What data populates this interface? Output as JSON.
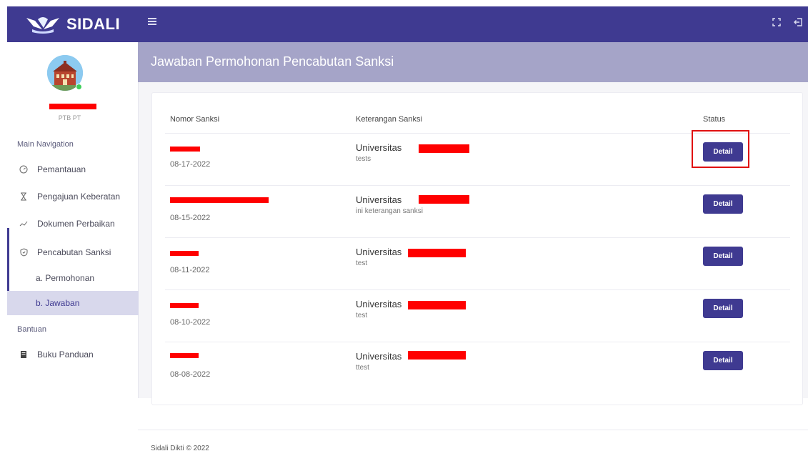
{
  "app": {
    "name": "SIDALI"
  },
  "navbar": {
    "menu_icon": "hamburger-icon",
    "fullscreen_icon": "fullscreen-icon",
    "logout_icon": "logout-icon"
  },
  "colors": {
    "primary": "#3f3a91",
    "header": "#a5a4c8",
    "active_nav": "#d8d8ec",
    "highlight": "#e01010",
    "redaction": "#ff0000"
  },
  "sidebar": {
    "user_role": "PTB PT",
    "sections": [
      {
        "label": "Main Navigation"
      },
      {
        "label": "Bantuan"
      }
    ],
    "items": [
      {
        "label": "Pemantauan",
        "icon": "gauge-icon"
      },
      {
        "label": "Pengajuan Keberatan",
        "icon": "hourglass-icon"
      },
      {
        "label": "Dokumen Perbaikan",
        "icon": "trend-icon"
      },
      {
        "label": "Pencabutan Sanksi",
        "icon": "shield-icon"
      },
      {
        "label": "a. Permohonan"
      },
      {
        "label": "b. Jawaban",
        "active": true
      },
      {
        "label": "Buku Panduan",
        "icon": "book-icon"
      }
    ]
  },
  "page": {
    "title": "Jawaban Permohonan Pencabutan Sanksi"
  },
  "table": {
    "headers": [
      "Nomor Sanksi",
      "Keterangan Sanksi",
      "Status"
    ],
    "rows": [
      {
        "date": "08-17-2022",
        "university": "Universitas",
        "note": "tests",
        "action": "Detail"
      },
      {
        "date": "08-15-2022",
        "university": "Universitas",
        "note": "ini keterangan sanksi",
        "action": "Detail"
      },
      {
        "date": "08-11-2022",
        "university": "Universitas",
        "note": "test",
        "action": "Detail"
      },
      {
        "date": "08-10-2022",
        "university": "Universitas",
        "note": "test",
        "action": "Detail"
      },
      {
        "date": "08-08-2022",
        "university": "Universitas",
        "note": "ttest",
        "action": "Detail"
      }
    ]
  },
  "footer": {
    "text": "Sidali Dikti © 2022"
  }
}
